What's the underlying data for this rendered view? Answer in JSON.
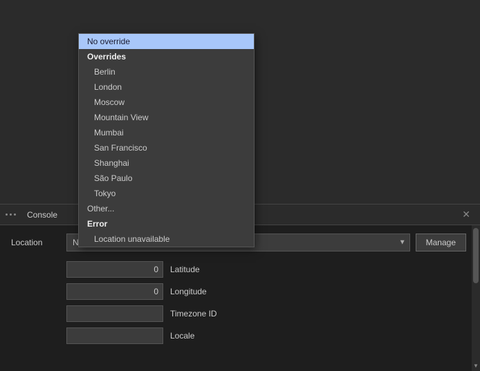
{
  "dropdown": {
    "selected_item": "No override",
    "groups": [
      {
        "type": "selected",
        "label": "No override"
      },
      {
        "type": "header",
        "label": "Overrides"
      },
      {
        "type": "item",
        "label": "Berlin"
      },
      {
        "type": "item",
        "label": "London"
      },
      {
        "type": "item",
        "label": "Moscow"
      },
      {
        "type": "item",
        "label": "Mountain View"
      },
      {
        "type": "item",
        "label": "Mumbai"
      },
      {
        "type": "item",
        "label": "San Francisco"
      },
      {
        "type": "item",
        "label": "Shanghai"
      },
      {
        "type": "item",
        "label": "São Paulo"
      },
      {
        "type": "item",
        "label": "Tokyo"
      },
      {
        "type": "other",
        "label": "Other..."
      },
      {
        "type": "error-header",
        "label": "Error"
      },
      {
        "type": "item",
        "label": "Location unavailable"
      }
    ]
  },
  "panel": {
    "dots_icon": "⋮",
    "tab_label": "Console",
    "close_icon": "✕",
    "location_label": "Location",
    "select_value": "No override",
    "select_arrow": "▼",
    "manage_button": "Manage",
    "fields": [
      {
        "label": "Latitude",
        "value": "0",
        "type": "number"
      },
      {
        "label": "Longitude",
        "value": "0",
        "type": "number"
      },
      {
        "label": "Timezone ID",
        "value": "",
        "type": "text"
      },
      {
        "label": "Locale",
        "value": "",
        "type": "text"
      }
    ],
    "scroll_arrow": "▼"
  }
}
